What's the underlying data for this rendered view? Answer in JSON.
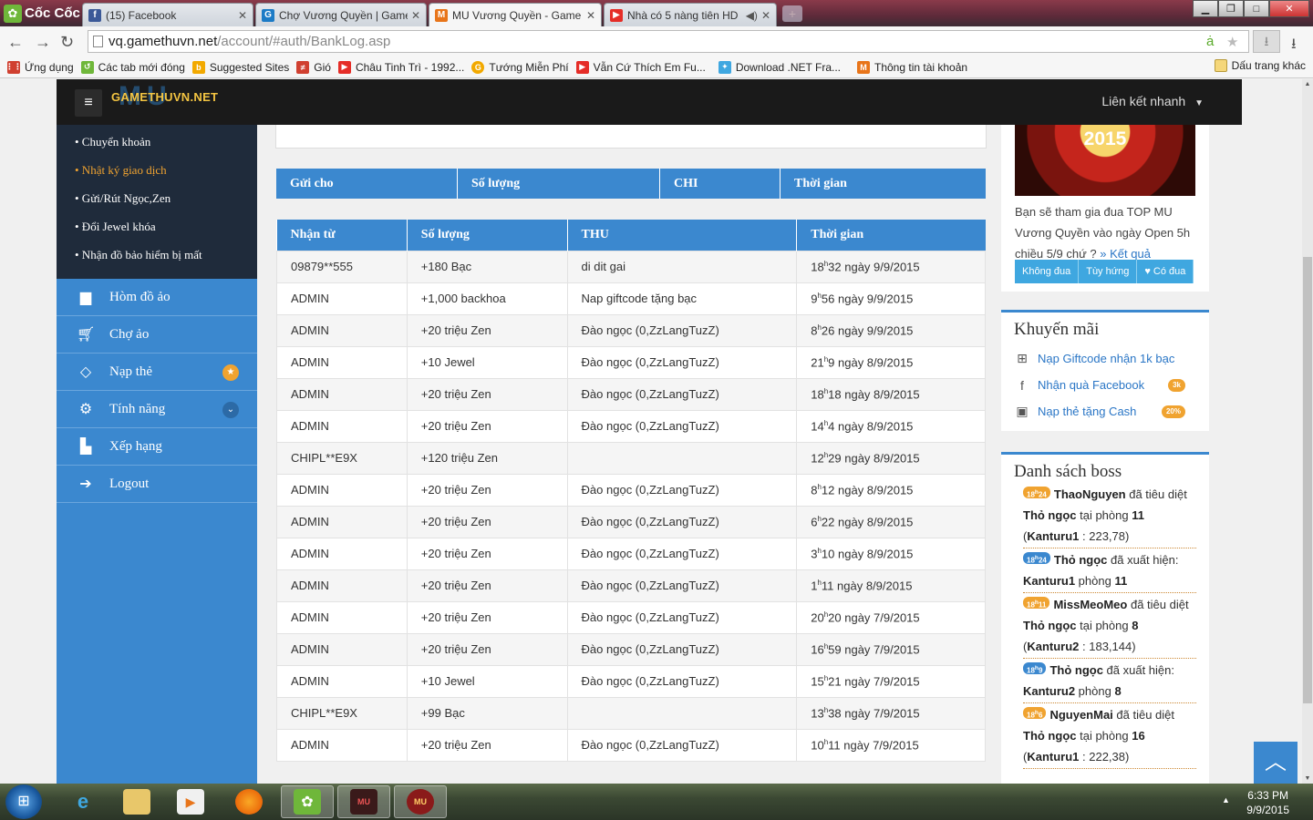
{
  "browser": {
    "app_name": "Cốc Cốc",
    "tabs": [
      {
        "title": "(15) Facebook",
        "icon": "facebook-icon",
        "color": "#3b5998"
      },
      {
        "title": "Chợ Vương Quyền | Game",
        "icon": "gamethuvn-icon",
        "color": "#1c7bc6"
      },
      {
        "title": "MU Vương Quyền - Game",
        "icon": "mu-icon",
        "color": "#e8751a"
      },
      {
        "title": "Nhà có 5 nàng tiên HD",
        "icon": "youtube-icon",
        "color": "#e52d27"
      }
    ],
    "url_host": "vq.gamethuvn.net",
    "url_path": "/account/#auth/BankLog.asp",
    "bookmarks": [
      {
        "label": "Ứng dụng",
        "icon": "apps-icon",
        "color": "#d04030"
      },
      {
        "label": "Các tab mới đóng",
        "icon": "recent-tabs-icon",
        "color": "#6fb73a"
      },
      {
        "label": "Suggested Sites",
        "icon": "bing-icon",
        "color": "#f2a900"
      },
      {
        "label": "Gió",
        "icon": "gio-icon",
        "color": "#d04030"
      },
      {
        "label": "Châu Tinh Trì - 1992...",
        "icon": "youtube-icon",
        "color": "#e52d27"
      },
      {
        "label": "Tướng Miễn Phí",
        "icon": "google-icon",
        "color": "#f2a900"
      },
      {
        "label": "Vẫn Cứ Thích Em Fu...",
        "icon": "youtube-icon",
        "color": "#e52d27"
      },
      {
        "label": "Download .NET Fra...",
        "icon": "dotnet-icon",
        "color": "#3fa7e0"
      },
      {
        "label": "Thông tin tài khoản",
        "icon": "mu-icon",
        "color": "#e8751a"
      }
    ],
    "bookmarks_other": "Dấu trang khác"
  },
  "site": {
    "brand": "GAMETHUVN.NET",
    "brand_mark": "MU",
    "quick_links": "Liên kết nhanh"
  },
  "sidebar": {
    "sub_items": [
      {
        "label": "• Chuyển khoản",
        "active": false
      },
      {
        "label": "• Nhật ký giao dịch",
        "active": true
      },
      {
        "label": "• Gửi/Rút Ngọc,Zen",
        "active": false
      },
      {
        "label": "• Đổi Jewel khóa",
        "active": false
      },
      {
        "label": "• Nhận đồ bảo hiểm bị mất",
        "active": false
      }
    ],
    "nav": [
      {
        "label": "Hòm đồ ảo",
        "icon": "briefcase-icon"
      },
      {
        "label": "Chợ ảo",
        "icon": "cart-icon"
      },
      {
        "label": "Nạp thẻ",
        "icon": "diamond-icon",
        "badge": "star"
      },
      {
        "label": "Tính năng",
        "icon": "gears-icon",
        "badge": "chevron"
      },
      {
        "label": "Xếp hạng",
        "icon": "bar-chart-icon"
      },
      {
        "label": "Logout",
        "icon": "logout-icon"
      }
    ]
  },
  "sent_table": {
    "headers": [
      "Gửi cho",
      "Số lượng",
      "CHI",
      "Thời gian"
    ]
  },
  "received_table": {
    "headers": [
      "Nhận từ",
      "Số lượng",
      "THU",
      "Thời gian"
    ],
    "rows": [
      {
        "from": "09879**555",
        "amount": "+180  Bạc",
        "note": "di dit gai",
        "h": "18",
        "m": "32",
        "date": " ngày 9/9/2015"
      },
      {
        "from": "ADMIN",
        "amount": "+1,000  backhoa",
        "note": "Nap giftcode tặng bạc",
        "h": "9",
        "m": "56",
        "date": " ngày 9/9/2015"
      },
      {
        "from": "ADMIN",
        "amount": "+20  triệu Zen",
        "note": "Đào ngọc (0,ZzLangTuzZ)",
        "h": "8",
        "m": "26",
        "date": " ngày 9/9/2015"
      },
      {
        "from": "ADMIN",
        "amount": "+10  Jewel",
        "note": "Đào ngọc (0,ZzLangTuzZ)",
        "h": "21",
        "m": "9",
        "date": " ngày 8/9/2015"
      },
      {
        "from": "ADMIN",
        "amount": "+20  triệu Zen",
        "note": "Đào ngọc (0,ZzLangTuzZ)",
        "h": "18",
        "m": "18",
        "date": " ngày 8/9/2015"
      },
      {
        "from": "ADMIN",
        "amount": "+20  triệu Zen",
        "note": "Đào ngọc (0,ZzLangTuzZ)",
        "h": "14",
        "m": "4",
        "date": " ngày 8/9/2015"
      },
      {
        "from": "CHIPL**E9X",
        "amount": "+120  triệu Zen",
        "note": "",
        "h": "12",
        "m": "29",
        "date": " ngày 8/9/2015"
      },
      {
        "from": "ADMIN",
        "amount": "+20  triệu Zen",
        "note": "Đào ngọc (0,ZzLangTuzZ)",
        "h": "8",
        "m": "12",
        "date": " ngày 8/9/2015"
      },
      {
        "from": "ADMIN",
        "amount": "+20  triệu Zen",
        "note": "Đào ngọc (0,ZzLangTuzZ)",
        "h": "6",
        "m": "22",
        "date": " ngày 8/9/2015"
      },
      {
        "from": "ADMIN",
        "amount": "+20  triệu Zen",
        "note": "Đào ngọc (0,ZzLangTuzZ)",
        "h": "3",
        "m": "10",
        "date": " ngày 8/9/2015"
      },
      {
        "from": "ADMIN",
        "amount": "+20  triệu Zen",
        "note": "Đào ngọc (0,ZzLangTuzZ)",
        "h": "1",
        "m": "11",
        "date": " ngày 8/9/2015"
      },
      {
        "from": "ADMIN",
        "amount": "+20  triệu Zen",
        "note": "Đào ngọc (0,ZzLangTuzZ)",
        "h": "20",
        "m": "20",
        "date": " ngày 7/9/2015"
      },
      {
        "from": "ADMIN",
        "amount": "+20  triệu Zen",
        "note": "Đào ngọc (0,ZzLangTuzZ)",
        "h": "16",
        "m": "59",
        "date": " ngày 7/9/2015"
      },
      {
        "from": "ADMIN",
        "amount": "+10  Jewel",
        "note": "Đào ngọc (0,ZzLangTuzZ)",
        "h": "15",
        "m": "21",
        "date": " ngày 7/9/2015"
      },
      {
        "from": "CHIPL**E9X",
        "amount": "+99  Bạc",
        "note": "",
        "h": "13",
        "m": "38",
        "date": " ngày 7/9/2015"
      },
      {
        "from": "ADMIN",
        "amount": "+20  triệu Zen",
        "note": "Đào ngọc (0,ZzLangTuzZ)",
        "h": "10",
        "m": "11",
        "date": " ngày 7/9/2015"
      }
    ]
  },
  "promo": {
    "year": "2015",
    "text": "Bạn sẽ tham gia đua TOP MU Vương Quyền vào ngày Open 5h chiều 5/9 chứ ? ",
    "link": "» Kết quả",
    "buttons": [
      "Không đua",
      "Tùy hứng",
      "♥ Có đua"
    ]
  },
  "promotions": {
    "title": "Khuyến mãi",
    "items": [
      {
        "label": "Nạp Giftcode nhận 1k bạc",
        "icon": "gift-icon",
        "pill": ""
      },
      {
        "label": "Nhận quà Facebook",
        "icon": "facebook-icon",
        "pill": "3k"
      },
      {
        "label": "Nạp thẻ tặng Cash",
        "icon": "money-icon",
        "pill": "20%"
      }
    ]
  },
  "bosses": {
    "title": "Danh sách boss",
    "items": [
      {
        "time_h": "18",
        "time_m": "24",
        "color": "#f0a330",
        "name": "ThaoNguyen",
        "text1": " đã tiêu diệt ",
        "boss": "Thỏ ngọc",
        "text2": " tại phòng ",
        "room": "11",
        "map": "Kanturu1",
        "coords": " : 223,78)"
      },
      {
        "time_h": "18",
        "time_m": "24",
        "color": "#3b88cf",
        "name": "",
        "text1": "",
        "boss": "Thỏ ngọc",
        "text2": " đã xuất hiện: ",
        "room": "11",
        "map": "Kanturu1",
        "coords": " phòng "
      },
      {
        "time_h": "18",
        "time_m": "11",
        "color": "#f0a330",
        "name": "MissMeoMeo",
        "text1": " đã tiêu diệt ",
        "boss": "Thỏ ngọc",
        "text2": " tại phòng ",
        "room": "8",
        "map": "Kanturu2",
        "coords": " : 183,144)"
      },
      {
        "time_h": "18",
        "time_m": "9",
        "color": "#3b88cf",
        "name": "",
        "text1": "",
        "boss": "Thỏ ngọc",
        "text2": " đã xuất hiện: ",
        "room": "8",
        "map": "Kanturu2",
        "coords": " phòng "
      },
      {
        "time_h": "18",
        "time_m": "6",
        "color": "#f0a330",
        "name": "NguyenMai",
        "text1": " đã tiêu diệt ",
        "boss": "Thỏ ngọc",
        "text2": " tại phòng ",
        "room": "16",
        "map": "Kanturu1",
        "coords": " : 222,38)"
      }
    ]
  },
  "taskbar": {
    "time": "6:33 PM",
    "date": "9/9/2015"
  },
  "colors": {
    "accent": "#3b88cf",
    "sidebar_dark": "#1f2b3b",
    "highlight": "#f0a330"
  }
}
